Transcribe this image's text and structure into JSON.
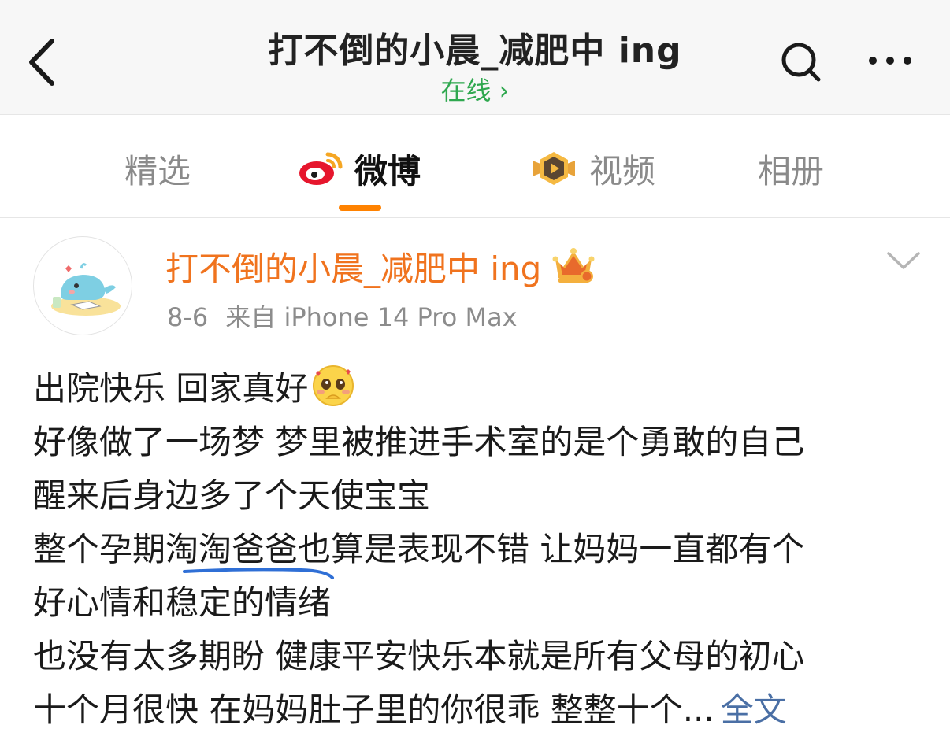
{
  "header": {
    "title": "打不倒的小晨_减肥中 ing",
    "status": "在线 ›"
  },
  "tabs": [
    {
      "label": "精选",
      "active": false
    },
    {
      "label": "微博",
      "active": true
    },
    {
      "label": "视频",
      "active": false
    },
    {
      "label": "相册",
      "active": false
    }
  ],
  "post": {
    "author": "打不倒的小晨_减肥中 ing",
    "date": "8-6",
    "source": "来自 iPhone 14 Pro Max",
    "lines": [
      "出院快乐 回家真好",
      "好像做了一场梦 梦里被推进手术室的是个勇敢的自己",
      "醒来后身边多了个天使宝宝",
      "整个孕期淘淘爸爸也算是表现不错 让妈妈一直都有个",
      "好心情和稳定的情绪",
      "也没有太多期盼 健康平安快乐本就是所有父母的初心",
      "十个月很快 在妈妈肚子里的你很乖 整整十个..."
    ],
    "full_text_link": "全文"
  },
  "colors": {
    "accent_orange": "#ff8200",
    "author_orange": "#f0731e",
    "online_green": "#2fa84f",
    "link_blue": "#4a6fa5"
  },
  "icons": [
    "back-icon",
    "search-icon",
    "more-icon",
    "weibo-logo-icon",
    "video-badge-icon",
    "vip-crown-icon",
    "chevron-down-icon",
    "emoji-blush-icon"
  ]
}
